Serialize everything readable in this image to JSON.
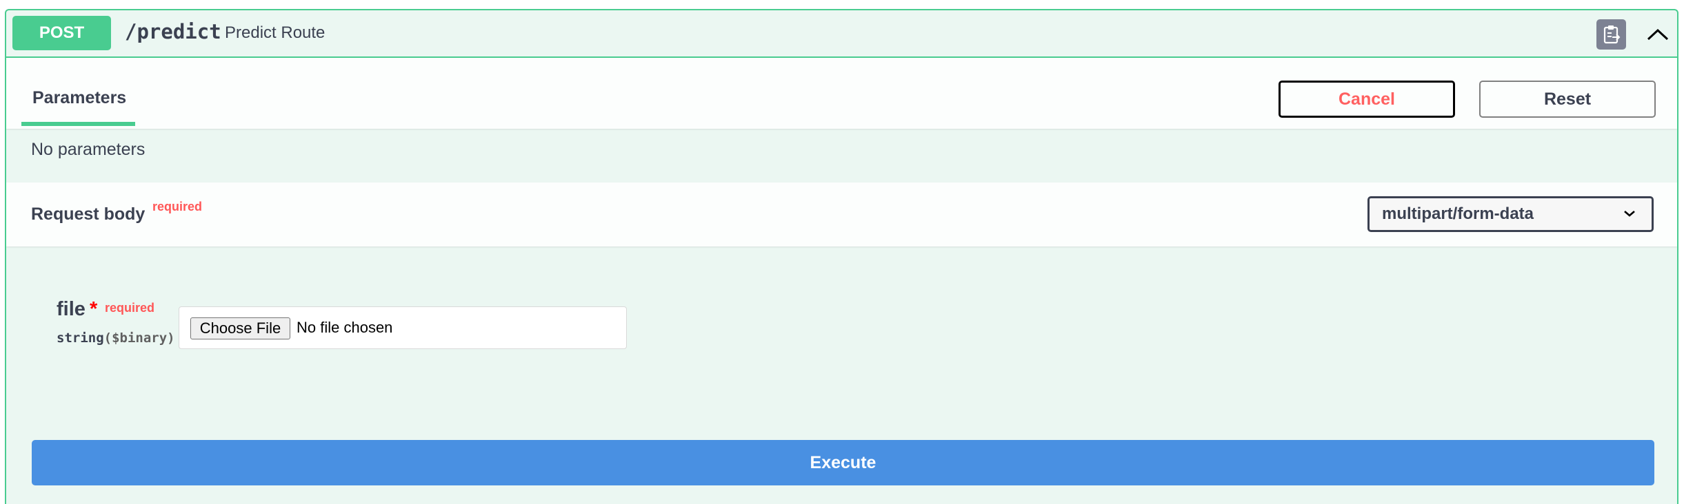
{
  "operation": {
    "method": "POST",
    "path": "/predict",
    "summary": "Predict Route",
    "method_color": "#49cc90"
  },
  "tabs": {
    "parameters_label": "Parameters"
  },
  "actions": {
    "cancel_label": "Cancel",
    "reset_label": "Reset",
    "execute_label": "Execute"
  },
  "parameters": {
    "empty_text": "No parameters"
  },
  "request_body": {
    "title": "Request body",
    "required_label": "required",
    "content_type": "multipart/form-data"
  },
  "file_field": {
    "name": "file",
    "star": "*",
    "required_label": "required",
    "type": "string",
    "format": "($binary)",
    "choose_label": "Choose File",
    "status": "No file chosen"
  },
  "icons": {
    "copy": "clipboard-icon",
    "collapse": "chevron-up-icon",
    "select": "chevron-down-icon"
  },
  "colors": {
    "accent_green": "#49cc90",
    "execute_blue": "#4990e2",
    "cancel_red": "#ff6060",
    "required_red": "#ff5757"
  }
}
